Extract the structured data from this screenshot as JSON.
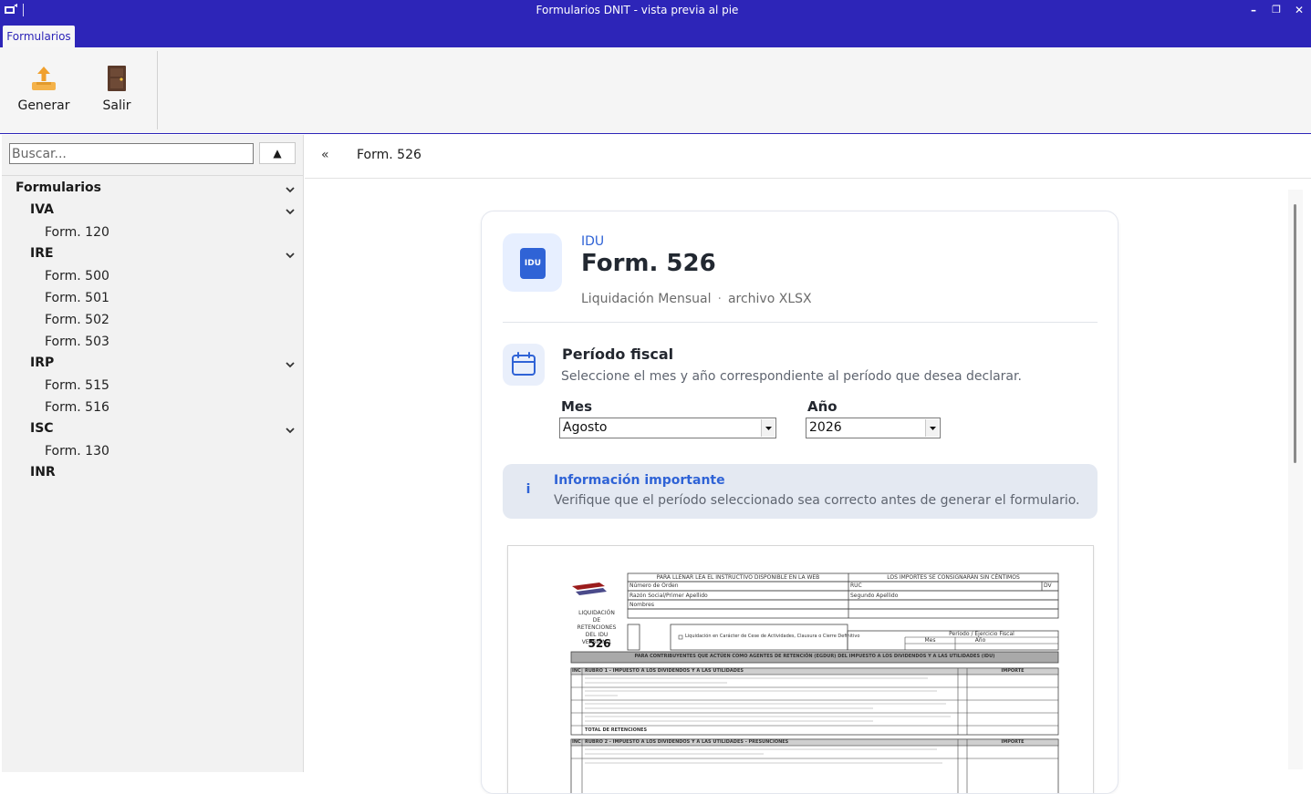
{
  "window": {
    "title": "Formularios DNIT - vista previa al pie",
    "controls": [
      "–",
      "❐",
      "✕"
    ]
  },
  "ribbon": {
    "tab": "Formularios",
    "buttons": [
      {
        "label": "Generar",
        "icon": "upload-icon"
      },
      {
        "label": "Salir",
        "icon": "door-icon"
      }
    ]
  },
  "sidebar": {
    "search_placeholder": "Buscar...",
    "sort_label": "▲",
    "root": "Formularios",
    "groups": [
      {
        "name": "IVA",
        "items": [
          "Form. 120"
        ]
      },
      {
        "name": "IRE",
        "items": [
          "Form. 500",
          "Form. 501",
          "Form. 502",
          "Form. 503"
        ]
      },
      {
        "name": "IRP",
        "items": [
          "Form. 515",
          "Form. 516"
        ]
      },
      {
        "name": "ISC",
        "items": [
          "Form. 130"
        ]
      },
      {
        "name": "INR",
        "items": []
      }
    ]
  },
  "header": {
    "collapse": "«",
    "breadcrumb": "Form. 526"
  },
  "card": {
    "badge": "IDU",
    "kind": "IDU",
    "title": "Form. 526",
    "meta_left": "Liquidación Mensual",
    "meta_sep": "·",
    "meta_right": "archivo XLSX",
    "period_title": "Período fiscal",
    "period_sub": "Seleccione el mes y año correspondiente al período que desea declarar.",
    "month_label": "Mes",
    "month_value": "Agosto",
    "year_label": "Año",
    "year_value": "2026",
    "info_icon": "i",
    "info_title": "Información importante",
    "info_text": "Verifique que el período seleccionado sea correcto antes de generar el formulario."
  },
  "preview": {
    "form_number": "526",
    "caption_left": "LIQUIDACIÓN DE RETENCIONES DEL IDU VERSIÓN 1",
    "head_left": "PARA LLENAR LEA EL INSTRUCTIVO DISPONIBLE EN LA WEB",
    "head_right": "LOS IMPORTES SE CONSIGNARÁN SIN CÉNTIMOS",
    "row_orden": "Número de Orden",
    "row_ruc": "RUC",
    "row_dv": "DV",
    "row_razon": "Razón Social/Primer Apellido",
    "row_segundo": "Segundo Apellido",
    "row_nombres": "Nombres",
    "row_cese": "Liquidación en Carácter de Cese de Actividades, Clausura o Cierre Definitivo",
    "row_periodo": "Período / Ejercicio Fiscal",
    "row_mes": "Mes",
    "row_ano": "Año",
    "banner": "PARA CONTRIBUYENTES QUE ACTÚEN COMO AGENTES DE RETENCIÓN (EGDUR) DEL IMPUESTO A LOS DIVIDENDOS Y A LAS UTILIDADES (IDU)",
    "rubro1": "RUBRO 1 - IMPUESTO A LOS DIVIDENDOS Y A LAS UTILIDADES",
    "rubro2": "RUBRO 2 - IMPUESTO A LOS DIVIDENDOS Y A LAS UTILIDADES - PRESUNCIONES",
    "importe": "IMPORTE",
    "total": "TOTAL DE RETENCIONES",
    "inc": "INC"
  }
}
